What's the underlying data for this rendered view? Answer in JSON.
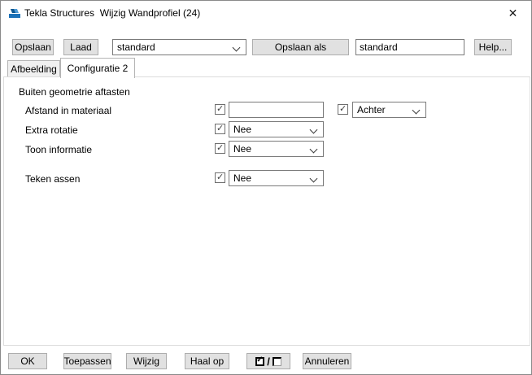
{
  "window": {
    "title": "Tekla Structures  Wijzig Wandprofiel (24)",
    "close_icon": "✕"
  },
  "toolbar": {
    "save_label": "Opslaan",
    "load_label": "Laad",
    "profile_dropdown_value": "standard",
    "save_as_label": "Opslaan als",
    "save_as_value": "standard",
    "help_label": "Help..."
  },
  "tabs": {
    "image_tab_label": "Afbeelding",
    "config_tab_label": "Configuratie 2",
    "active_tab": "Configuratie 2"
  },
  "content": {
    "group_title": "Buiten geometrie aftasten",
    "row_afstand": {
      "label": "Afstand in materiaal",
      "checked": true,
      "value": "",
      "side_checked": true,
      "side_dropdown_value": "Achter"
    },
    "row_rotatie": {
      "label": "Extra rotatie",
      "checked": true,
      "dropdown_value": "Nee"
    },
    "row_informatie": {
      "label": "Toon informatie",
      "checked": true,
      "dropdown_value": "Nee"
    },
    "row_assen": {
      "label": "Teken assen",
      "checked": true,
      "dropdown_value": "Nee"
    }
  },
  "footer": {
    "ok_label": "OK",
    "apply_label": "Toepassen",
    "modify_label": "Wijzig",
    "get_label": "Haal op",
    "toggle_slash": "/",
    "cancel_label": "Annuleren"
  },
  "colors": {
    "tekla_blue": "#1d72b8",
    "tekla_dark_blue": "#10578f",
    "button_bg": "#e1e1e1",
    "button_border": "#adadad",
    "input_border": "#7a7a7a"
  }
}
